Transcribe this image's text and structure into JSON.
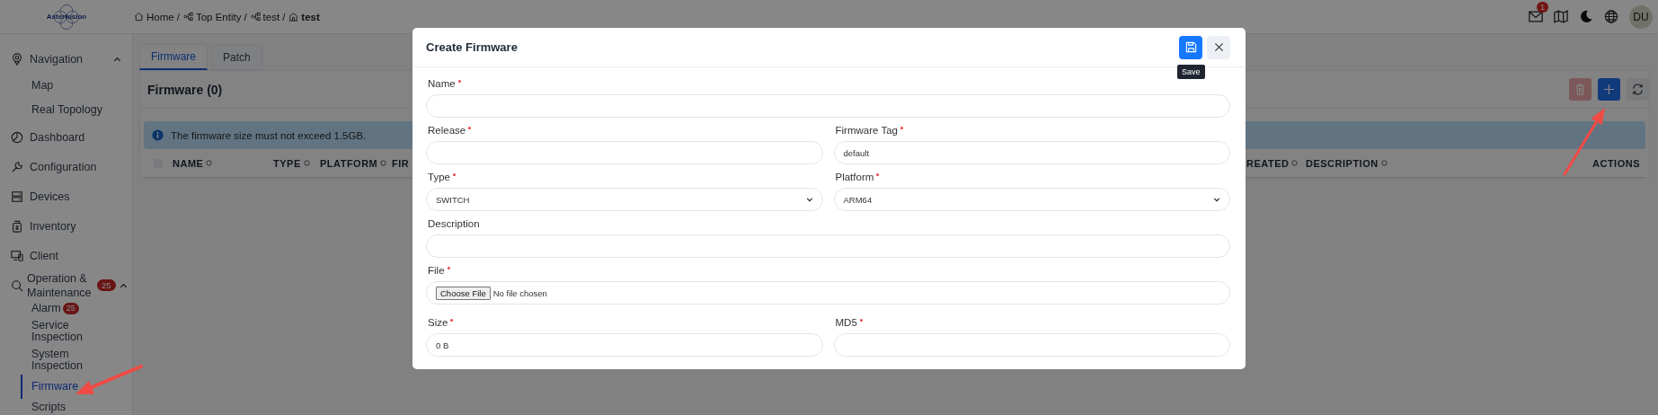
{
  "topbar": {
    "logo": "Asterfusion",
    "separator": "/",
    "breadcrumb": [
      {
        "label": "Home",
        "kind": "home",
        "current": false
      },
      {
        "label": "Top Entity",
        "kind": "entity",
        "current": false
      },
      {
        "label": "test",
        "kind": "entity",
        "current": false
      },
      {
        "label": "test",
        "kind": "building",
        "current": true
      }
    ],
    "mail_badge": "1",
    "avatar": "DU"
  },
  "sidebar": {
    "items": [
      {
        "label": "Navigation",
        "expanded": true,
        "children": [
          {
            "label": "Map",
            "selected": false
          },
          {
            "label": "Real Topology",
            "selected": false
          }
        ]
      },
      {
        "label": "Dashboard"
      },
      {
        "label": "Configuration"
      },
      {
        "label": "Devices"
      },
      {
        "label": "Inventory"
      },
      {
        "label": "Client"
      },
      {
        "label": "Operation & Maintenance",
        "badge": "25",
        "expanded": true,
        "children": [
          {
            "label": "Alarm",
            "badge": "25",
            "selected": false
          },
          {
            "label": "Service Inspection",
            "selected": false
          },
          {
            "label": "System Inspection",
            "selected": false
          },
          {
            "label": "Firmware",
            "selected": true
          },
          {
            "label": "Scripts",
            "selected": false
          }
        ]
      }
    ]
  },
  "tabs": [
    {
      "label": "Firmware",
      "selected": true
    },
    {
      "label": "Patch",
      "selected": false
    }
  ],
  "panel": {
    "title": "Firmware (0)",
    "toolbar": [
      {
        "kind": "delete",
        "disabled": true
      },
      {
        "kind": "add",
        "disabled": false
      },
      {
        "kind": "refresh",
        "disabled": false
      }
    ],
    "info": "The firmware size must not exceed 1.5GB."
  },
  "table": {
    "select_all": {
      "checked": false
    },
    "columns": [
      {
        "label": "NAME",
        "sortable": true
      },
      {
        "label": "TYPE",
        "sortable": true
      },
      {
        "label": "PLATFORM",
        "sortable": true
      },
      {
        "label": "FIR",
        "sortable": false
      },
      {
        "label": "REATED",
        "sortable": true
      },
      {
        "label": "DESCRIPTION",
        "sortable": true
      },
      {
        "label": "ACTIONS",
        "sortable": false
      }
    ]
  },
  "dialog": {
    "title": "Create Firmware",
    "tooltip": "Save",
    "fields": [
      {
        "label": "Name",
        "required": true,
        "kind": "text",
        "wide": true
      },
      {
        "label": "Release",
        "required": true,
        "kind": "text",
        "wide": false
      },
      {
        "label": "Firmware Tag",
        "required": true,
        "kind": "text",
        "wide": false,
        "value": "default"
      },
      {
        "label": "Type",
        "required": true,
        "kind": "select",
        "wide": false,
        "value": "SWITCH"
      },
      {
        "label": "Platform",
        "required": true,
        "kind": "select",
        "wide": false,
        "value": "ARM64"
      },
      {
        "label": "Description",
        "required": false,
        "kind": "text",
        "wide": true
      },
      {
        "label": "File",
        "required": true,
        "kind": "file",
        "wide": true,
        "button": "Choose File",
        "value": "No file chosen"
      },
      {
        "label": "Size",
        "required": true,
        "kind": "text",
        "wide": false,
        "value": "0 B"
      },
      {
        "label": "MD5",
        "required": true,
        "kind": "text",
        "wide": false
      }
    ]
  }
}
